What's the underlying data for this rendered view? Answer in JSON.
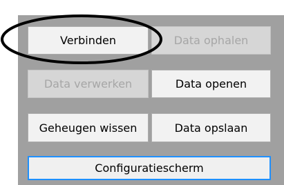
{
  "buttons": {
    "connect": {
      "label": "Verbinden",
      "enabled": true
    },
    "fetch_data": {
      "label": "Data ophalen",
      "enabled": false
    },
    "process_data": {
      "label": "Data verwerken",
      "enabled": false
    },
    "open_data": {
      "label": "Data openen",
      "enabled": true
    },
    "clear_memory": {
      "label": "Geheugen wissen",
      "enabled": true
    },
    "save_data": {
      "label": "Data opslaan",
      "enabled": true
    },
    "configuration": {
      "label": "Configuratiescherm",
      "enabled": true,
      "is_default": true
    }
  },
  "colors": {
    "panel_background": "#a0a0a0",
    "button_face": "#f2f2f2",
    "disabled_face": "#d6d6d6",
    "disabled_text": "#a6a6a6",
    "focus_border": "#1e90ff",
    "annotation_ellipse": "#000000"
  },
  "annotation": {
    "shape": "ellipse",
    "highlights": "connect"
  }
}
